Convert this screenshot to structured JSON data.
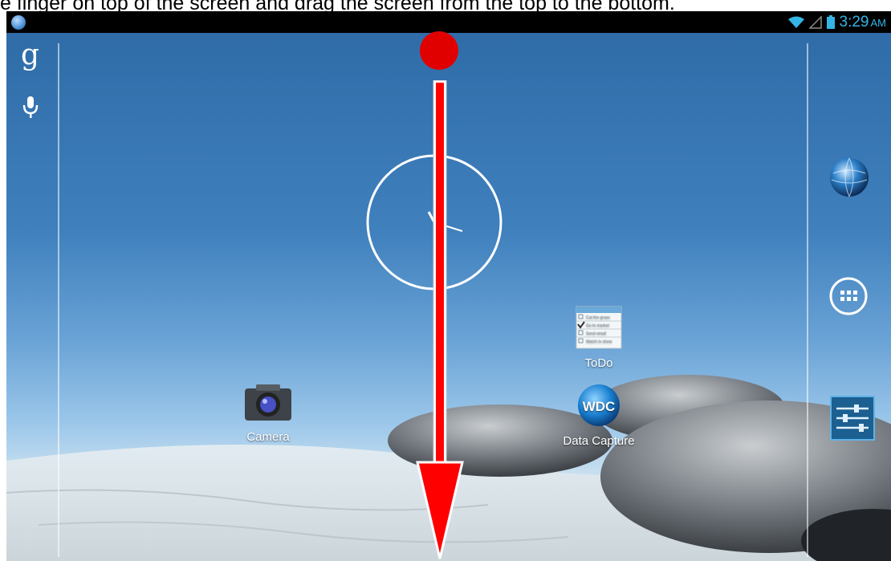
{
  "instruction": {
    "text": "e finger on top of the screen and drag the screen from the top to the bottom."
  },
  "status_bar": {
    "time": "3:29",
    "ampm": "AM",
    "accent_color": "#34b5e5"
  },
  "left_rail": {
    "google_label": "g",
    "icons": [
      "google-search-icon",
      "microphone-icon"
    ]
  },
  "apps": [
    {
      "label": "ToDo",
      "icon": "todo-icon"
    },
    {
      "label": "Camera",
      "icon": "camera-icon"
    },
    {
      "label": "Data Capture",
      "icon": "wdc-icon",
      "icon_text": "WDC"
    }
  ],
  "todo_icon_lines": [
    "Cut the grass",
    "Go to market",
    "Send email",
    "Watch tv show"
  ],
  "right_rail": {
    "icons": [
      "browser-globe-icon",
      "all-apps-icon",
      "settings-sliders-icon"
    ]
  },
  "overlay": {
    "hint_dot_color": "#e10000",
    "arrow_color": "#ff0000"
  }
}
